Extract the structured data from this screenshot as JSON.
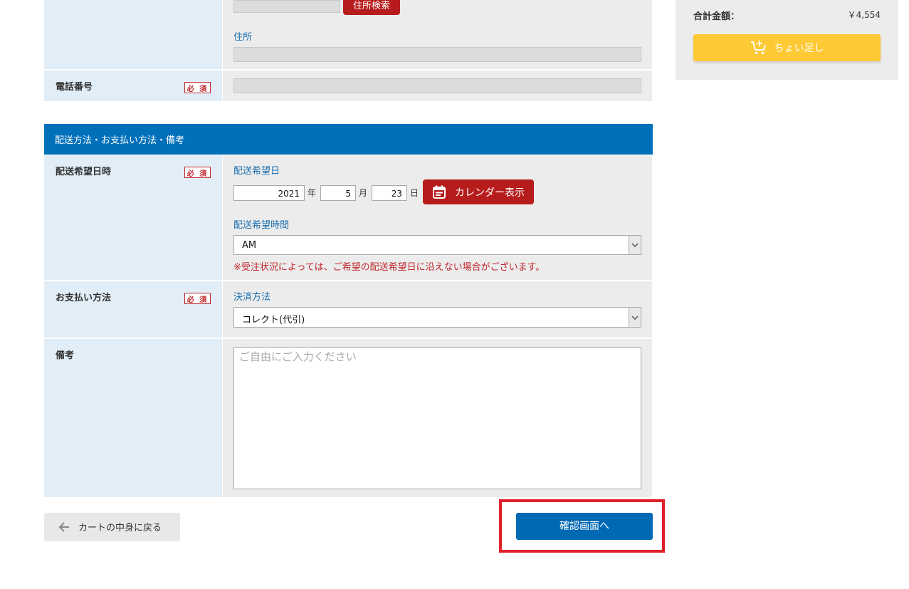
{
  "address": {
    "search_button": "住所検索",
    "address_label": "住所"
  },
  "phone": {
    "label": "電話番号",
    "required": "必 須"
  },
  "delivery_section": {
    "title": "配送方法・お支払い方法・備考",
    "date_label": "配送希望日時",
    "required": "必 須",
    "date_sub": "配送希望日",
    "year": "2021",
    "year_unit": "年",
    "month": "5",
    "month_unit": "月",
    "day": "23",
    "day_unit": "日",
    "calendar_button": "カレンダー表示",
    "time_sub": "配送希望時間",
    "time_value": "AM",
    "notice": "※受注状況によっては、ご希望の配送希望日に沿えない場合がございます。"
  },
  "payment": {
    "label": "お支払い方法",
    "required": "必 須",
    "sub": "決済方法",
    "value": "コレクト(代引)"
  },
  "remarks": {
    "label": "備考",
    "placeholder": "ご自由にご入力ください"
  },
  "actions": {
    "back_label": "カートの中身に戻る",
    "confirm_label": "確認画面へ"
  },
  "sidebar": {
    "total_label": "合計金額：",
    "total_value": "￥4,554",
    "add_more_label": "ちょい足し"
  },
  "colors": {
    "section_header": "#0070bb",
    "accent_red": "#b71c1c",
    "confirm_blue": "#0069b4",
    "highlight_box": "#e0202a",
    "yellow_button": "#fdc934"
  }
}
